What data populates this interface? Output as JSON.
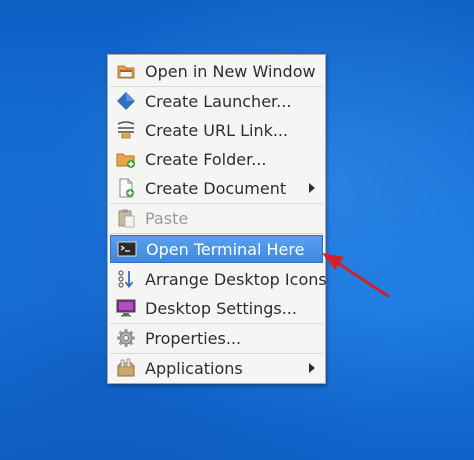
{
  "context_menu": {
    "items": [
      {
        "label": "Open in New Window",
        "icon": "folder-window-icon"
      },
      {
        "label": "Create Launcher...",
        "icon": "launcher-diamond-icon"
      },
      {
        "label": "Create URL Link...",
        "icon": "url-link-icon"
      },
      {
        "label": "Create Folder...",
        "icon": "folder-add-icon"
      },
      {
        "label": "Create Document",
        "icon": "document-add-icon",
        "submenu": true
      },
      {
        "label": "Paste",
        "icon": "clipboard-icon",
        "disabled": true
      },
      {
        "label": "Open Terminal Here",
        "icon": "terminal-icon",
        "highlighted": true
      },
      {
        "label": "Arrange Desktop Icons",
        "icon": "arrange-icons-icon"
      },
      {
        "label": "Desktop Settings...",
        "icon": "monitor-icon"
      },
      {
        "label": "Properties...",
        "icon": "gear-icon"
      },
      {
        "label": "Applications",
        "icon": "applications-icon",
        "submenu": true
      }
    ]
  },
  "colors": {
    "desktop_background": "#1670d6",
    "menu_background": "#f5f5f4",
    "highlight": "#4a90e2",
    "annotation_arrow": "#d0202a"
  }
}
